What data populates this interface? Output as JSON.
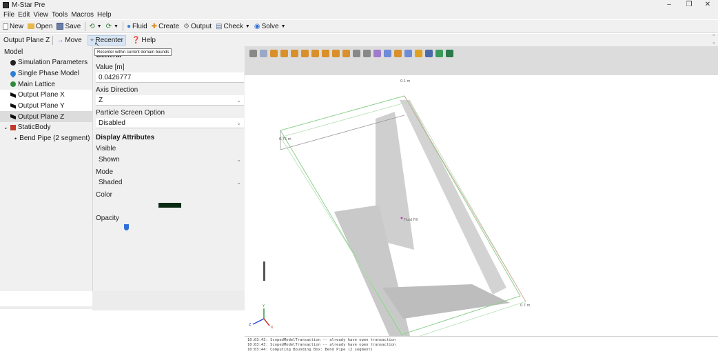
{
  "window": {
    "title": "M-Star Pre",
    "controls": [
      "–",
      "❐",
      "✕"
    ]
  },
  "menu": [
    "File",
    "Edit",
    "View",
    "Tools",
    "Macros",
    "Help"
  ],
  "toolbar": {
    "new_label": "New",
    "open_label": "Open",
    "save_label": "Save",
    "fluid_label": "Fluid",
    "create_label": "Create",
    "output_label": "Output",
    "check_label": "Check",
    "solve_label": "Solve"
  },
  "toolbar2": {
    "context_label": "Output Plane Z",
    "move_label": "Move",
    "recenter_label": "Recenter",
    "help_label": "Help",
    "tooltip": "Recenter within current domain bounds"
  },
  "model_tree": {
    "header": "Model",
    "items": [
      {
        "label": "Simulation Parameters",
        "icon": "gear-icon"
      },
      {
        "label": "Single Phase Model",
        "icon": "droplet-icon"
      },
      {
        "label": "Main Lattice",
        "icon": "lattice-icon"
      },
      {
        "label": "Output Plane X",
        "icon": "plane-icon"
      },
      {
        "label": "Output Plane Y",
        "icon": "plane-icon"
      },
      {
        "label": "Output Plane Z",
        "icon": "plane-icon"
      },
      {
        "label": "StaticBody",
        "icon": "static-body-icon"
      },
      {
        "label": "Bend Pipe (2 segment)",
        "icon": "bullet-icon"
      }
    ]
  },
  "properties": {
    "section_general": "General",
    "value_label": "Value [m]",
    "value": "0.0426777",
    "axis_label": "Axis Direction",
    "axis_value": "Z",
    "particle_label": "Particle Screen Option",
    "particle_value": "Disabled",
    "section_display": "Display Attributes",
    "visible_label": "Visible",
    "visible_value": "Shown",
    "mode_label": "Mode",
    "mode_value": "Shaded",
    "color_label": "Color",
    "color_value": "#0b2a14",
    "opacity_label": "Opacity"
  },
  "viewport": {
    "label_top": "0.1 m",
    "label_left": "0.75 m",
    "label_bottom": "0.7 m",
    "fluid_fill_label": "Fluid Fill",
    "axes": {
      "x": "X",
      "y": "Y",
      "z": "Z"
    }
  },
  "console": {
    "lines": [
      "10:03:43: ScopedModelTransaction -- already have open transaction",
      "10:03:43: ScopedModelTransaction -- already have open transaction",
      "10:03:44: Computing Bounding Box: Bend Pipe (2 segment)"
    ]
  },
  "colors": {
    "accent": "#2f6fd6",
    "selection_bg": "#ffffff",
    "panel_bg": "#f0f0f0",
    "domain_box": "#8fd08f",
    "pipe": "#c8c8c8"
  }
}
